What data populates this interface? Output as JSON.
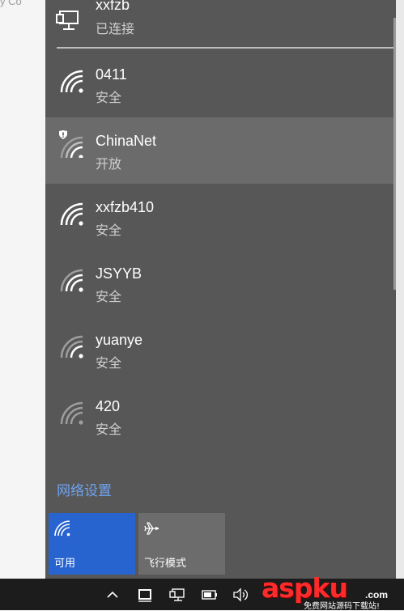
{
  "background": {
    "peek_text": "y Co"
  },
  "connected_network": {
    "name": "xxfzb",
    "status": "已连接",
    "icon": "ethernet-icon"
  },
  "networks": [
    {
      "name": "0411",
      "status": "安全",
      "icon": "wifi-strong-icon"
    },
    {
      "name": "ChinaNet",
      "status": "开放",
      "icon": "wifi-open-warning-icon"
    },
    {
      "name": "xxfzb410",
      "status": "安全",
      "icon": "wifi-strong-icon"
    },
    {
      "name": "JSYYB",
      "status": "安全",
      "icon": "wifi-medium-icon"
    },
    {
      "name": "yuanye",
      "status": "安全",
      "icon": "wifi-weak-icon"
    },
    {
      "name": "420",
      "status": "安全",
      "icon": "wifi-weak-icon"
    }
  ],
  "network_settings_label": "网络设置",
  "quick_actions": {
    "wifi": {
      "label": "可用",
      "icon": "wifi-icon",
      "color": "#2864d0"
    },
    "airplane": {
      "label": "飞行模式",
      "icon": "airplane-icon",
      "color": "#6c6c6c"
    }
  },
  "taskbar": {
    "icons": [
      "chevron-up-icon",
      "tablet-icon",
      "network-icon",
      "battery-icon",
      "volume-icon"
    ]
  },
  "watermark": {
    "brand": "aspku",
    "tld": ".com",
    "tagline": "免费网站源码下载站!"
  },
  "colors": {
    "flyout_bg": "#575757",
    "highlight_bg": "#6b6b6b",
    "accent": "#2864d0",
    "link": "#6fa3f0"
  }
}
